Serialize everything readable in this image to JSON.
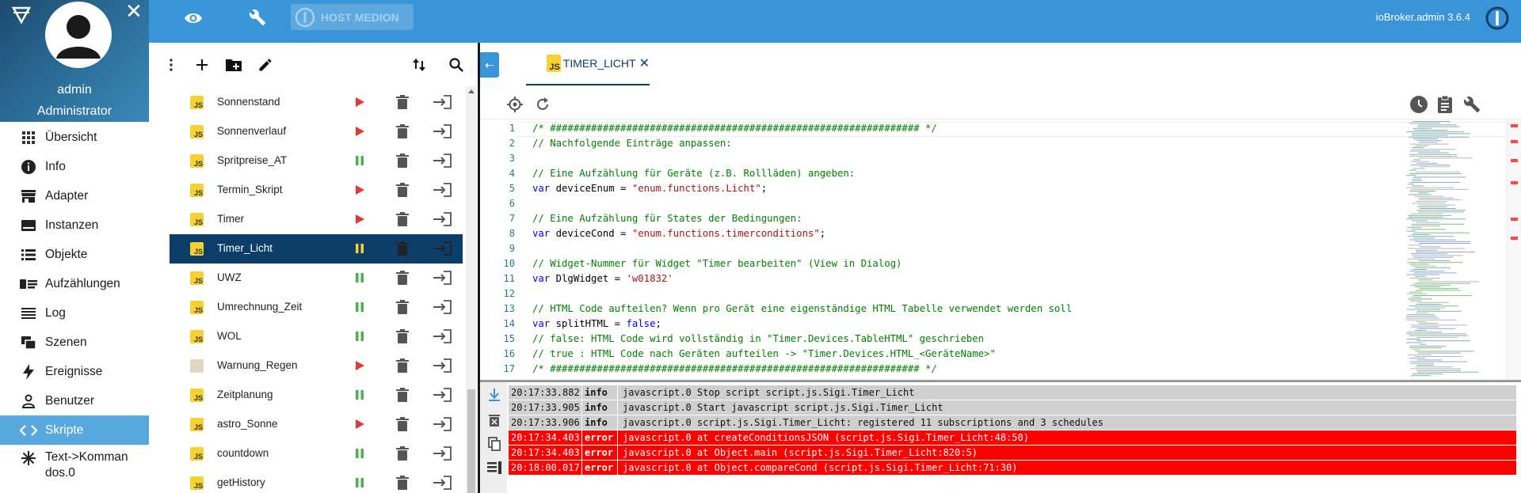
{
  "nav": {
    "user_name": "admin",
    "user_role": "Administrator",
    "items": [
      {
        "label": "Übersicht",
        "icon": "grid-icon"
      },
      {
        "label": "Info",
        "icon": "info-icon"
      },
      {
        "label": "Adapter",
        "icon": "store-icon"
      },
      {
        "label": "Instanzen",
        "icon": "instances-icon"
      },
      {
        "label": "Objekte",
        "icon": "list-icon"
      },
      {
        "label": "Aufzählungen",
        "icon": "enum-icon"
      },
      {
        "label": "Log",
        "icon": "log-icon"
      },
      {
        "label": "Szenen",
        "icon": "scenes-icon"
      },
      {
        "label": "Ereignisse",
        "icon": "flash-icon"
      },
      {
        "label": "Benutzer",
        "icon": "person-icon"
      },
      {
        "label": "Skripte",
        "icon": "code-icon",
        "active": true
      },
      {
        "label": "Text->Kommandos.0",
        "icon": "snowflake-icon"
      }
    ]
  },
  "topbar": {
    "host_label": "HOST MEDION",
    "version": "ioBroker.admin 3.6.4",
    "color": "#3a95d8"
  },
  "scripts": {
    "rows": [
      {
        "name": "Sonnenstand",
        "state": "stopped",
        "type": "js"
      },
      {
        "name": "Sonnenverlauf",
        "state": "stopped",
        "type": "js"
      },
      {
        "name": "Spritpreise_AT",
        "state": "running",
        "type": "js"
      },
      {
        "name": "Termin_Skript",
        "state": "stopped",
        "type": "js"
      },
      {
        "name": "Timer",
        "state": "stopped",
        "type": "js"
      },
      {
        "name": "Timer_Licht",
        "state": "running",
        "type": "js",
        "selected": true
      },
      {
        "name": "UWZ",
        "state": "running",
        "type": "js"
      },
      {
        "name": "Umrechnung_Zeit",
        "state": "running",
        "type": "js"
      },
      {
        "name": "WOL",
        "state": "running",
        "type": "js"
      },
      {
        "name": "Warnung_Regen",
        "state": "stopped",
        "type": "ts"
      },
      {
        "name": "Zeitplanung",
        "state": "running",
        "type": "js"
      },
      {
        "name": "astro_Sonne",
        "state": "stopped",
        "type": "js"
      },
      {
        "name": "countdown",
        "state": "running",
        "type": "js"
      },
      {
        "name": "getHistory",
        "state": "running",
        "type": "js"
      }
    ]
  },
  "editor": {
    "tab_label": "TIMER_LICHT",
    "js_badge": "JS",
    "lines": [
      {
        "n": "1",
        "parts": [
          {
            "c": "com",
            "t": "/* ############################################################### */"
          }
        ]
      },
      {
        "n": "2",
        "parts": [
          {
            "c": "com",
            "t": "// Nachfolgende Einträge anpassen:"
          }
        ]
      },
      {
        "n": "3",
        "parts": []
      },
      {
        "n": "4",
        "parts": [
          {
            "c": "com",
            "t": "// Eine Aufzählung für Geräte (z.B. Rollläden) angeben:"
          }
        ]
      },
      {
        "n": "5",
        "parts": [
          {
            "c": "kw",
            "t": "var"
          },
          {
            "c": "",
            "t": " deviceEnum = "
          },
          {
            "c": "str",
            "t": "\"enum.functions.Licht\""
          },
          {
            "c": "",
            "t": ";"
          }
        ]
      },
      {
        "n": "6",
        "parts": []
      },
      {
        "n": "7",
        "parts": [
          {
            "c": "com",
            "t": "// Eine Aufzählung für States der Bedingungen:"
          }
        ]
      },
      {
        "n": "8",
        "parts": [
          {
            "c": "kw",
            "t": "var"
          },
          {
            "c": "",
            "t": " deviceCond = "
          },
          {
            "c": "str",
            "t": "\"enum.functions.timerconditions\""
          },
          {
            "c": "",
            "t": ";"
          }
        ]
      },
      {
        "n": "9",
        "parts": []
      },
      {
        "n": "10",
        "parts": [
          {
            "c": "com",
            "t": "// Widget-Nummer für Widget \"Timer bearbeiten\" (View in Dialog)"
          }
        ]
      },
      {
        "n": "11",
        "parts": [
          {
            "c": "kw",
            "t": "var"
          },
          {
            "c": "",
            "t": " DlgWidget = "
          },
          {
            "c": "str",
            "t": "'w01832'"
          }
        ]
      },
      {
        "n": "12",
        "parts": []
      },
      {
        "n": "13",
        "parts": [
          {
            "c": "com",
            "t": "// HTML Code aufteilen? Wenn pro Gerät eine eigenständige HTML Tabelle verwendet werden soll"
          }
        ]
      },
      {
        "n": "14",
        "parts": [
          {
            "c": "kw",
            "t": "var"
          },
          {
            "c": "",
            "t": " splitHTML = "
          },
          {
            "c": "kw",
            "t": "false"
          },
          {
            "c": "",
            "t": ";"
          }
        ]
      },
      {
        "n": "15",
        "parts": [
          {
            "c": "com",
            "t": "// false: HTML Code wird vollständig in \"Timer.Devices.TableHTML\" geschrieben"
          }
        ]
      },
      {
        "n": "16",
        "parts": [
          {
            "c": "com",
            "t": "// true : HTML Code nach Geräten aufteilen -> \"Timer.Devices.HTML_<GeräteName>\""
          }
        ]
      },
      {
        "n": "17",
        "parts": [
          {
            "c": "com",
            "t": "/* ############################################################### */"
          }
        ]
      }
    ]
  },
  "log": {
    "rows": [
      {
        "time": "20:17:33.882",
        "level": "info",
        "msg": "javascript.0 Stop script script.js.Sigi.Timer_Licht"
      },
      {
        "time": "20:17:33.905",
        "level": "info",
        "msg": "javascript.0 Start javascript script.js.Sigi.Timer_Licht"
      },
      {
        "time": "20:17:33.906",
        "level": "info",
        "msg": "javascript.0 script.js.Sigi.Timer_Licht: registered 11 subscriptions and 3 schedules"
      },
      {
        "time": "20:17:34.403",
        "level": "error",
        "msg": "javascript.0 at createConditionsJSON (script.js.Sigi.Timer_Licht:48:50)"
      },
      {
        "time": "20:17:34.403",
        "level": "error",
        "msg": "javascript.0 at Object.main (script.js.Sigi.Timer_Licht:820:5)"
      },
      {
        "time": "20:18:00.017",
        "level": "error",
        "msg": "javascript.0 at Object.compareCond (script.js.Sigi.Timer_Licht:71:30)"
      }
    ]
  }
}
